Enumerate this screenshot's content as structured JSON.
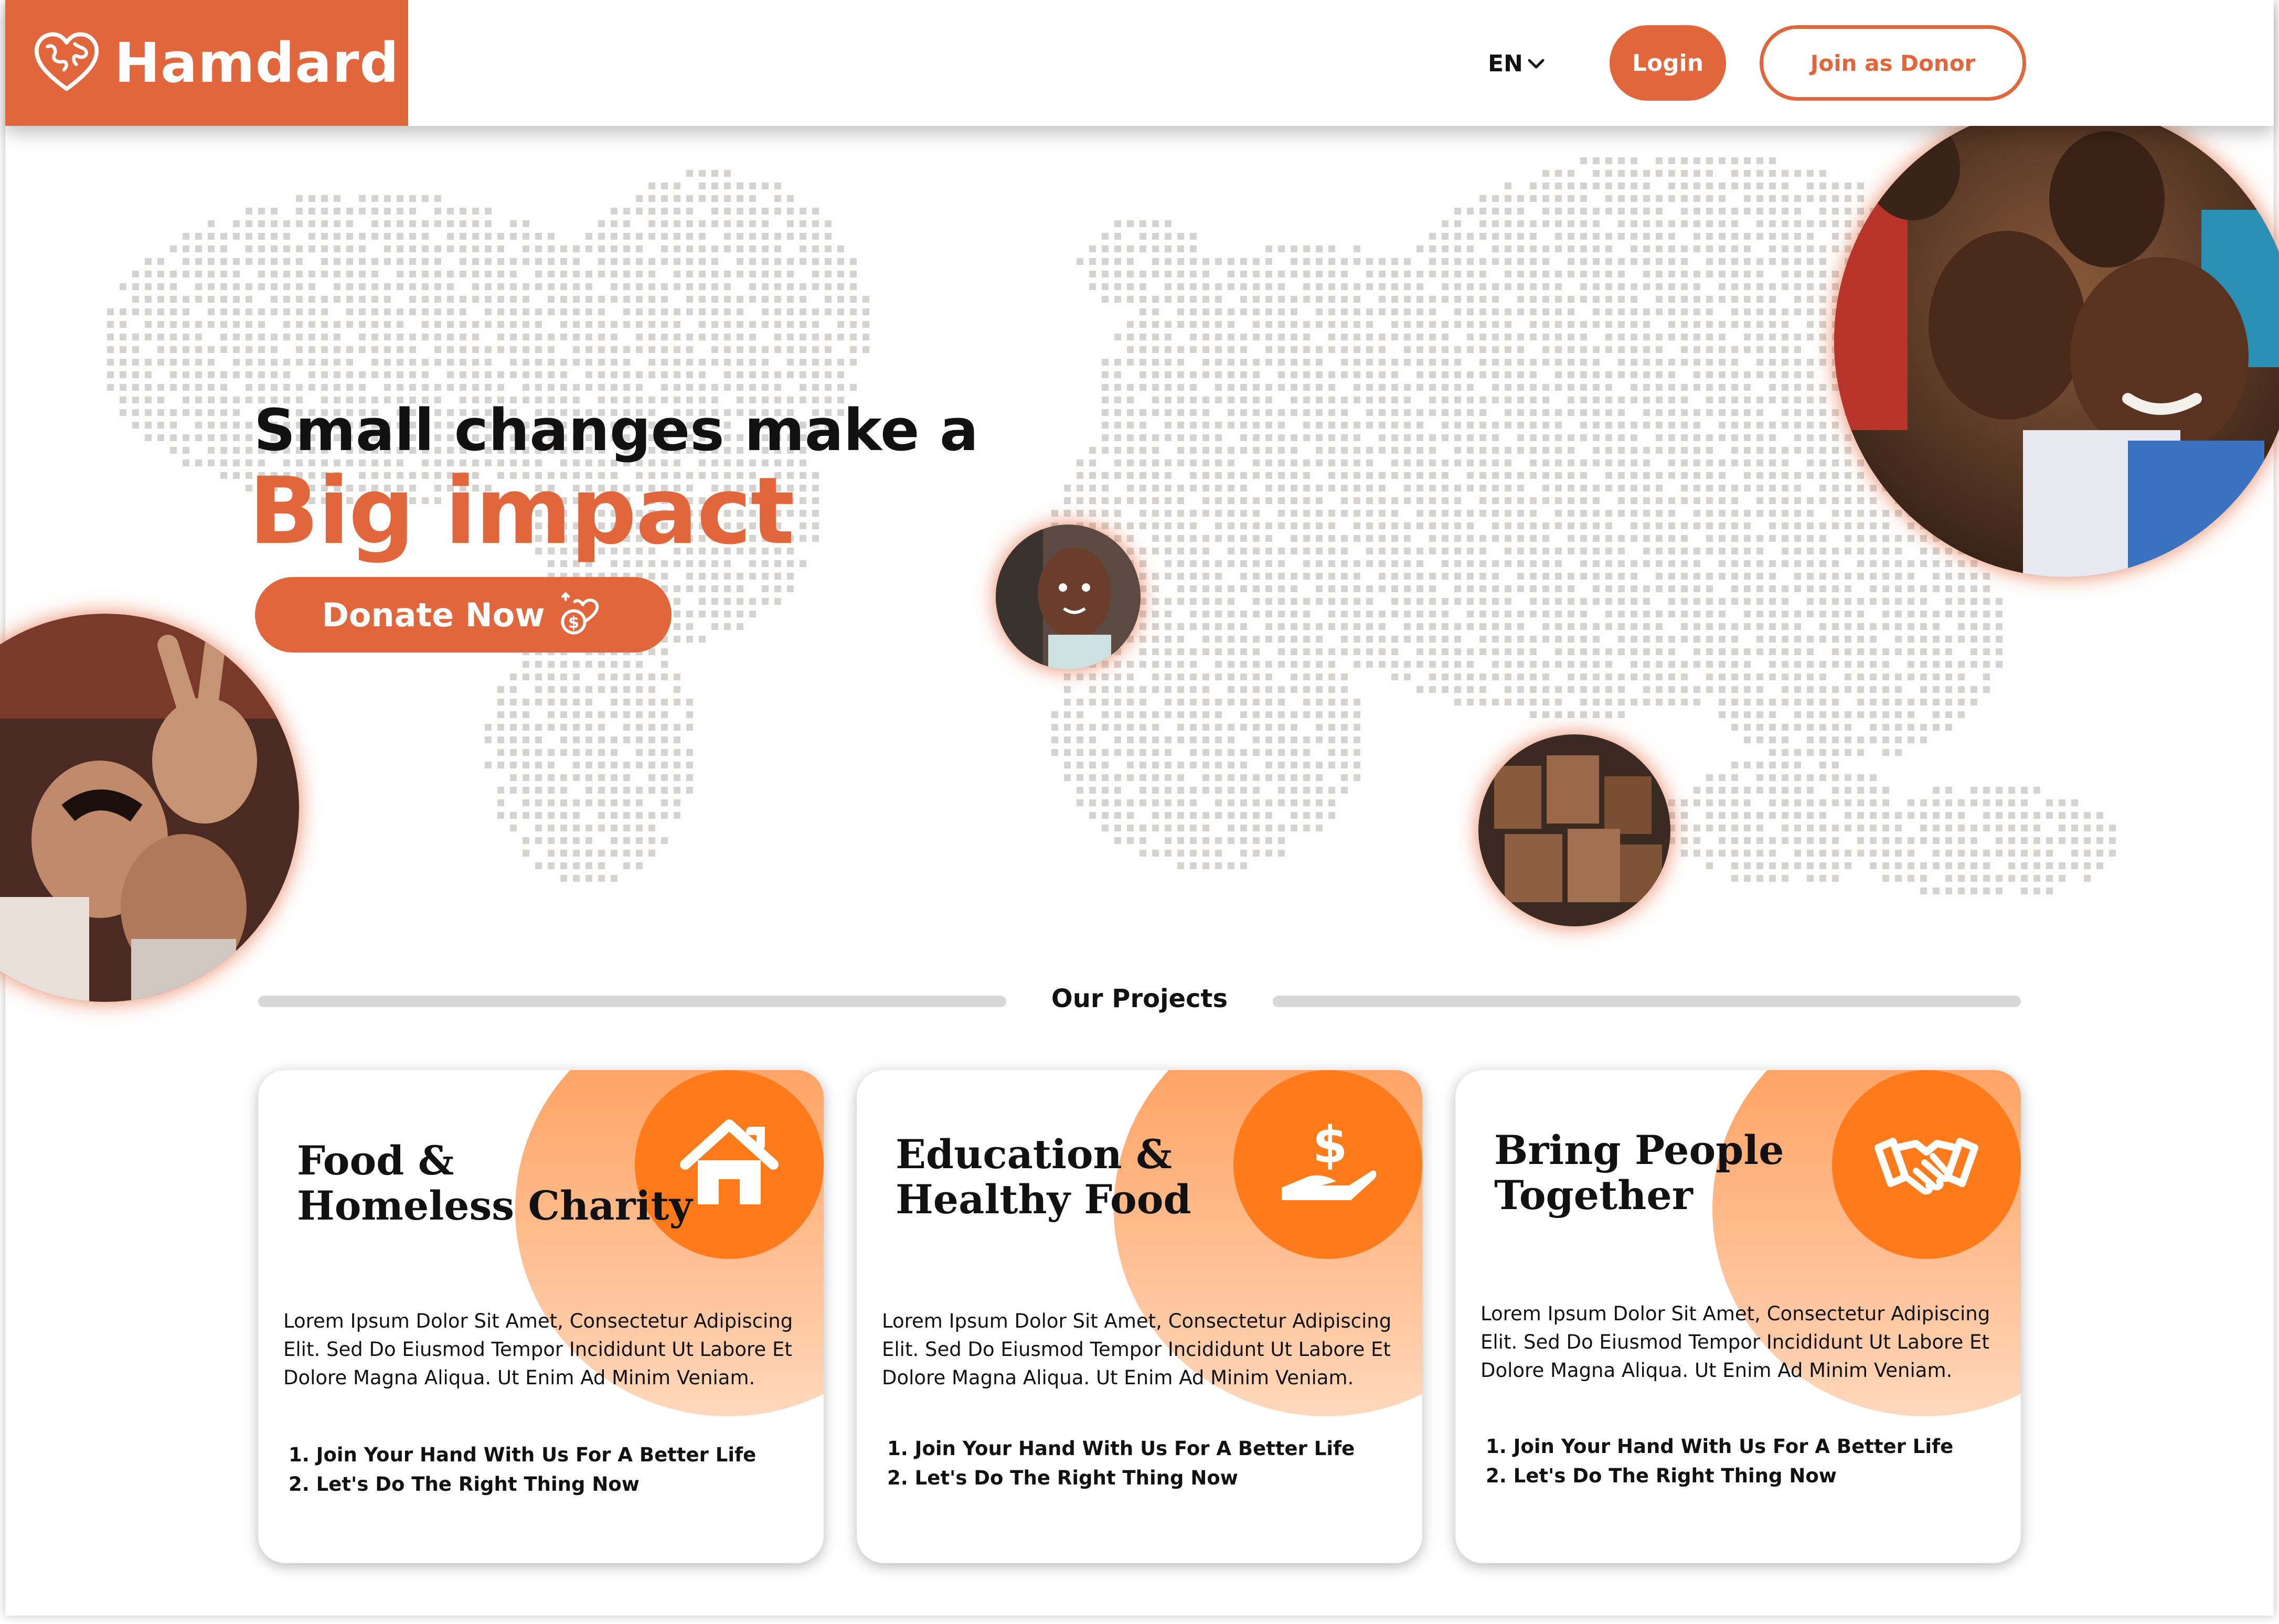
{
  "brand": {
    "name": "Hamdard",
    "color": "#e2663c",
    "accent": "#ff7a1a"
  },
  "header": {
    "language": "EN",
    "login_label": "Login",
    "donor_label": "Join as Donor"
  },
  "hero": {
    "line1": "Small changes make a",
    "line2": "Big impact",
    "donate_label": "Donate Now"
  },
  "projects": {
    "title": "Our Projects",
    "cards": [
      {
        "title": "Food &\nHomeless Charity",
        "icon": "house-icon",
        "body": "Lorem Ipsum Dolor Sit Amet, Consectetur Adipiscing Elit. Sed Do Eiusmod Tempor Incididunt Ut Labore Et Dolore Magna Aliqua. Ut Enim Ad Minim Veniam.",
        "items": [
          "1. Join Your Hand With Us For A Better Life",
          "2. Let's Do The Right Thing Now"
        ]
      },
      {
        "title": "Education &\nHealthy Food",
        "icon": "hand-dollar-icon",
        "body": "Lorem Ipsum Dolor Sit Amet, Consectetur Adipiscing Elit. Sed Do Eiusmod Tempor Incididunt Ut Labore Et Dolore Magna Aliqua. Ut Enim Ad Minim Veniam.",
        "items": [
          "1. Join Your Hand With Us For A Better Life",
          "2. Let's Do The Right Thing Now"
        ]
      },
      {
        "title": "Bring People\nTogether",
        "icon": "handshake-icon",
        "body": "Lorem Ipsum Dolor Sit Amet, Consectetur Adipiscing Elit. Sed Do Eiusmod Tempor Incididunt Ut Labore Et Dolore Magna Aliqua. Ut Enim Ad Minim Veniam.",
        "items": [
          "1. Join Your Hand With Us For A Better Life",
          "2. Let's Do The Right Thing Now"
        ]
      }
    ]
  }
}
